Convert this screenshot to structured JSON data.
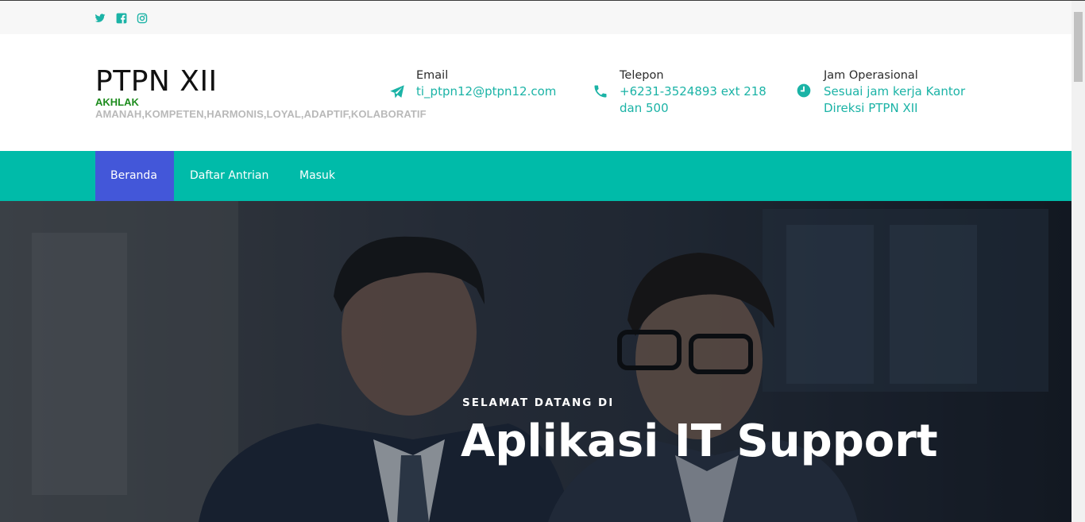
{
  "topbar": {
    "social": [
      {
        "icon": "twitter-icon",
        "label": "Twitter"
      },
      {
        "icon": "facebook-icon",
        "label": "Facebook"
      },
      {
        "icon": "instagram-icon",
        "label": "Instagram"
      }
    ]
  },
  "brand": {
    "title": "PTPN XII",
    "subtitle": "AKHLAK",
    "values": "AMANAH,KOMPETEN,HARMONIS,LOYAL,ADAPTIF,KOLABORATIF"
  },
  "contact": {
    "email": {
      "icon": "paper-plane-icon",
      "label": "Email",
      "value": "ti_ptpn12@ptpn12.com"
    },
    "phone": {
      "icon": "phone-icon",
      "label": "Telepon",
      "line1": "+6231-3524893 ext 218",
      "line2": "dan 500"
    },
    "hours": {
      "icon": "clock-icon",
      "label": "Jam Operasional",
      "line1": "Sesuai jam kerja Kantor",
      "line2": "Direksi PTPN XII"
    }
  },
  "nav": {
    "items": [
      "Beranda",
      "Daftar Antrian",
      "Masuk"
    ],
    "active": "Beranda"
  },
  "hero": {
    "kicker": "SELAMAT DATANG DI",
    "title": "Aplikasi IT Support"
  },
  "colors": {
    "accent": "#00bba9",
    "nav_active": "#4357d9",
    "brand_green": "#1d8c1d",
    "link_teal": "#1bb3a6"
  }
}
